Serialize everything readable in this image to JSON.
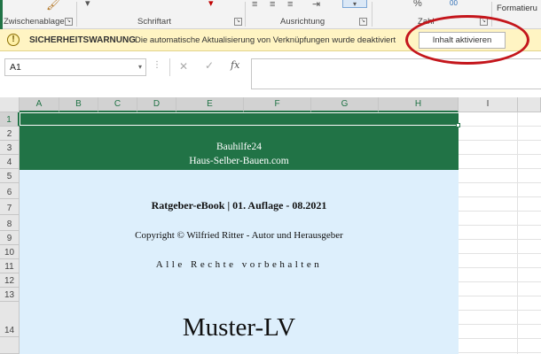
{
  "ribbon": {
    "groups": [
      {
        "label": "Zwischenablage"
      },
      {
        "label": "Schriftart"
      },
      {
        "label": "Ausrichtung"
      },
      {
        "label": "Zahl"
      }
    ],
    "format_label": "Formatieru",
    "percent_glyph": "%",
    "zeros_glyph": "00",
    "launcher_glyph": "↘"
  },
  "security_bar": {
    "icon": "shield-warning-icon",
    "icon_glyph": "!",
    "title": "SICHERHEITSWARNUNG",
    "message": "Die automatische Aktualisierung von Verknüpfungen wurde deaktiviert",
    "button_label": "Inhalt aktivieren",
    "highlight_color": "#c4161c"
  },
  "formula_bar": {
    "name_box": "A1",
    "name_box_arrow": "▾",
    "dots": "⋮",
    "cancel_glyph": "✕",
    "enter_glyph": "✓",
    "fx_label": "fx",
    "formula": ""
  },
  "grid": {
    "columns": [
      "A",
      "B",
      "C",
      "D",
      "E",
      "F",
      "G",
      "H",
      "I"
    ],
    "rows": [
      "1",
      "2",
      "3",
      "4",
      "5",
      "6",
      "7",
      "8",
      "9",
      "10",
      "11",
      "12",
      "13",
      "14"
    ],
    "selected_cell": "A1"
  },
  "content": {
    "brand": "Bauhilfe24",
    "site": "Haus-Selber-Bauen.com",
    "title": "Ratgeber-eBook | 01. Auflage - 08.2021",
    "copyright": "Copyright © Wilfried Ritter - Autor und Herausgeber",
    "rights": "Alle Rechte vorbehalten",
    "heading": "Muster-LV"
  },
  "colors": {
    "excel_green": "#217346",
    "light_band": "#ddeffc",
    "warning_bar": "#fff4c3"
  }
}
